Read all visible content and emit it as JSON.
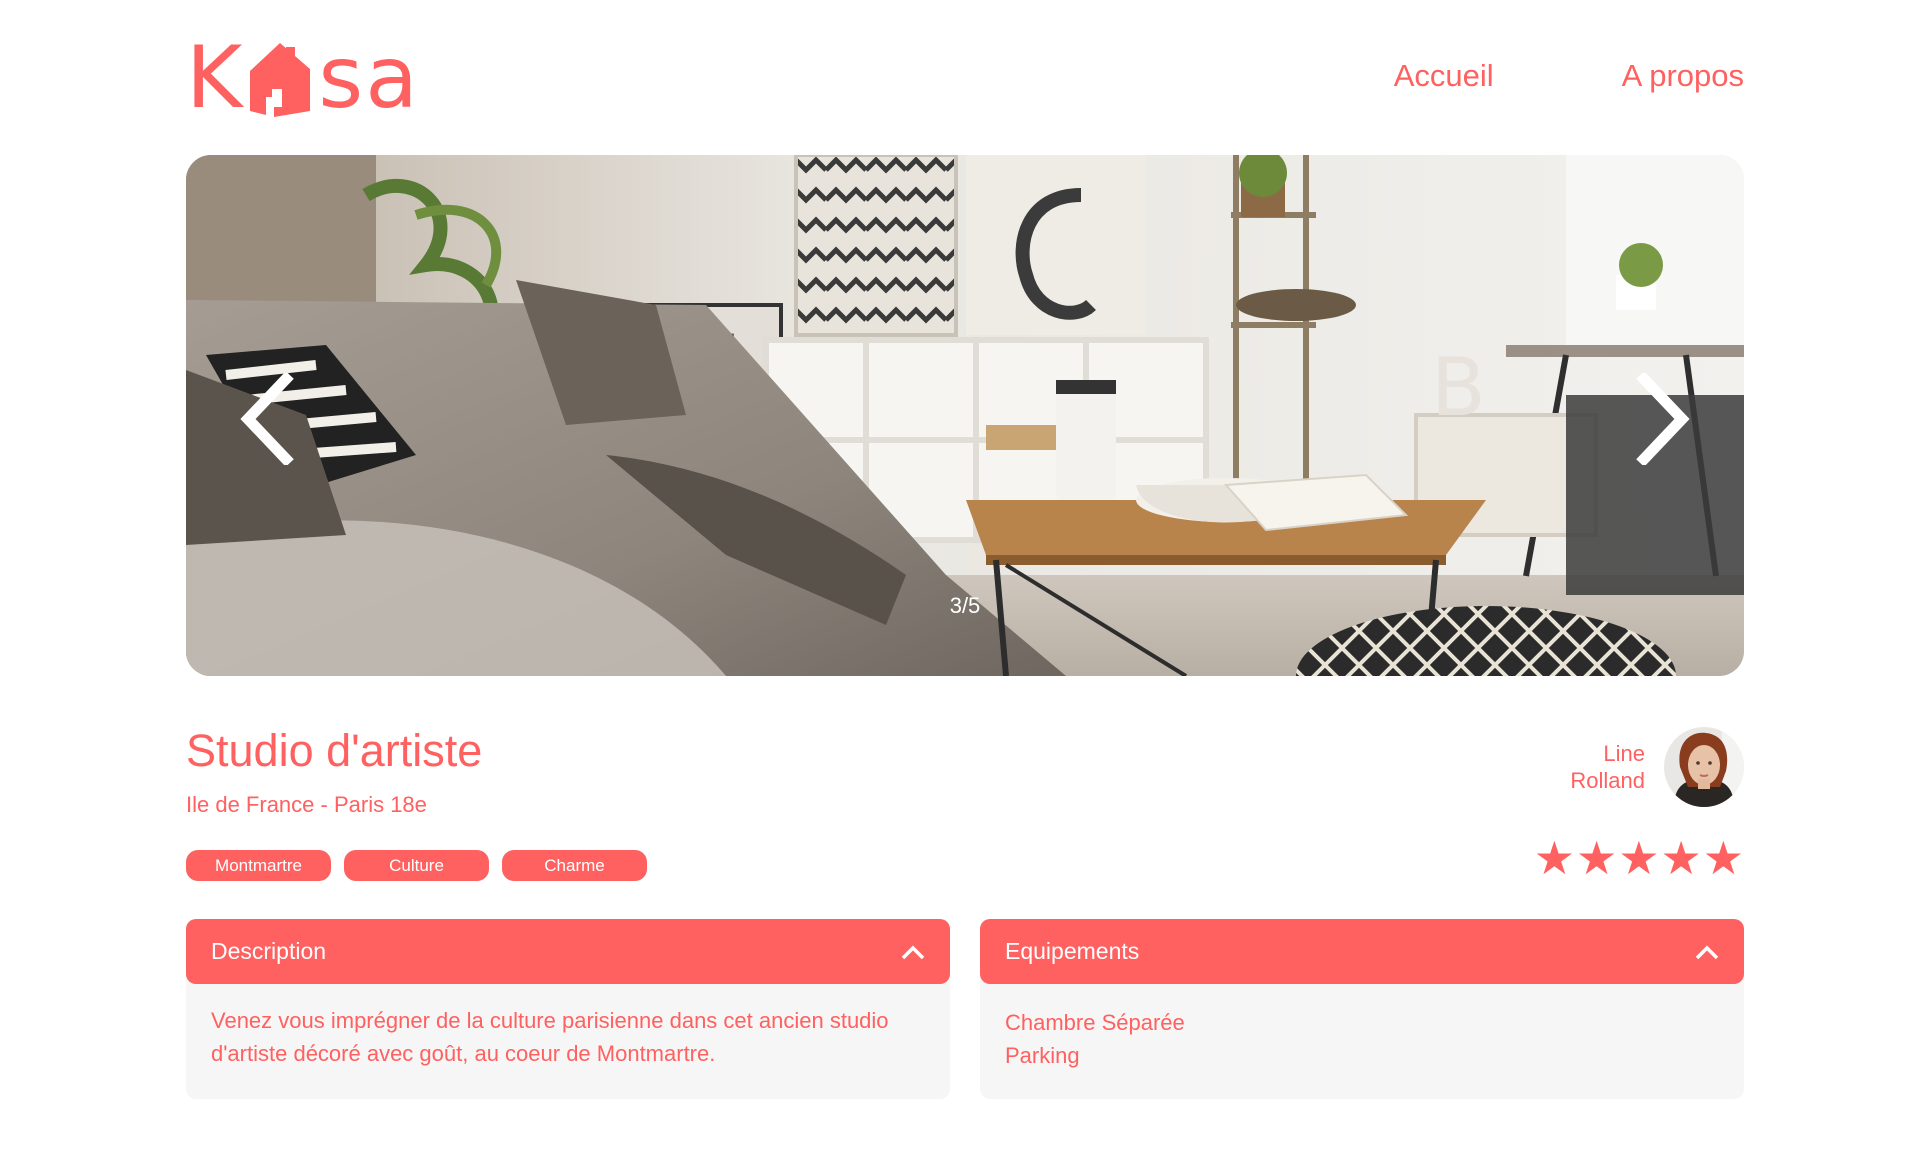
{
  "header": {
    "logo_text": "Kasa",
    "nav": [
      {
        "label": "Accueil"
      },
      {
        "label": "A propos"
      }
    ]
  },
  "carousel": {
    "counter": "3/5",
    "current": 3,
    "total": 5,
    "prev_icon": "chevron-left-icon",
    "next_icon": "chevron-right-icon"
  },
  "listing": {
    "title": "Studio d'artiste",
    "location": "Ile de France - Paris 18e",
    "tags": [
      "Montmartre",
      "Culture",
      "Charme"
    ],
    "host": {
      "first_name": "Line",
      "last_name": "Rolland"
    },
    "rating": 5,
    "rating_max": 5
  },
  "collapses": {
    "description": {
      "title": "Description",
      "text": "Venez vous imprégner de la culture parisienne dans cet ancien studio d'artiste décoré avec goût, au coeur de Montmartre."
    },
    "equipments": {
      "title": "Equipements",
      "items": [
        "Chambre Séparée",
        "Parking"
      ]
    }
  },
  "colors": {
    "accent": "#FF6060",
    "panel_bg": "#F6F6F6",
    "text_light": "#FFFFFF"
  }
}
